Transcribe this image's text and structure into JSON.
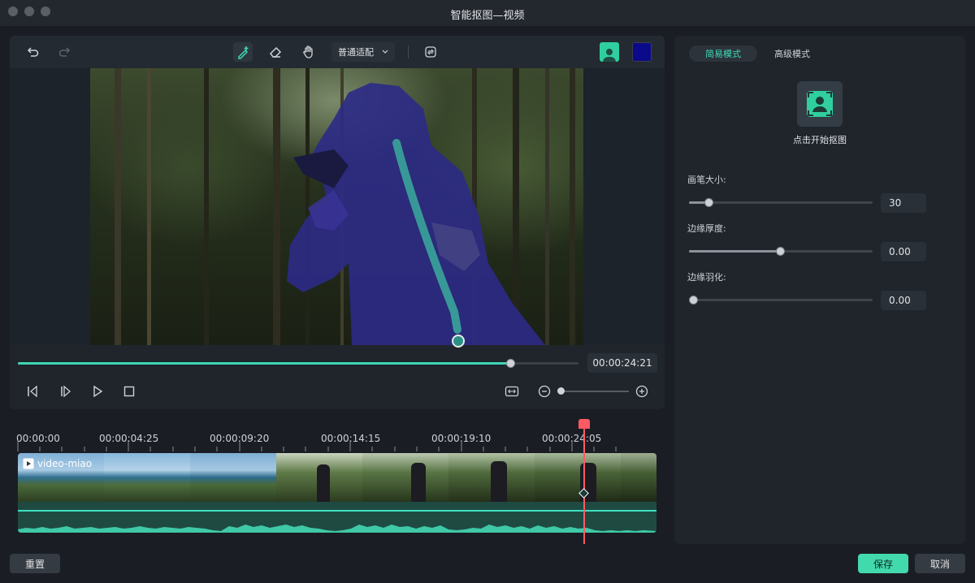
{
  "window": {
    "title": "智能抠图—视频"
  },
  "toolbar": {
    "fit_label": "普通适配",
    "mask_color": "#0a0a8a",
    "icons": [
      "undo-icon",
      "redo-icon",
      "brush-add-icon",
      "eraser-icon",
      "hand-icon",
      "chevron-down-icon",
      "swap-icon",
      "person-icon"
    ]
  },
  "player": {
    "progress": 0.88,
    "timecode": "00:00:24:21",
    "zoom_level": 0.0
  },
  "right_panel": {
    "tabs": [
      {
        "label": "简易模式",
        "active": true
      },
      {
        "label": "高级模式",
        "active": false
      }
    ],
    "cutout_label": "点击开始抠图",
    "settings": [
      {
        "label": "画笔大小:",
        "value": "30",
        "fraction": 0.11
      },
      {
        "label": "边缘厚度:",
        "value": "0.00",
        "fraction": 0.5
      },
      {
        "label": "边缘羽化:",
        "value": "0.00",
        "fraction": 0.0
      }
    ]
  },
  "timeline": {
    "ruler": [
      "00:00:00",
      "00:00:04:25",
      "00:00:09:20",
      "00:00:14:15",
      "00:00:19:10",
      "00:00:24:05"
    ],
    "clip_name": "video-miao"
  },
  "footer": {
    "reset_label": "重置",
    "save_label": "保存",
    "cancel_label": "取消"
  },
  "colors": {
    "accent": "#3fd6b5",
    "save": "#42d9ad",
    "playhead": "#ff5a64"
  }
}
